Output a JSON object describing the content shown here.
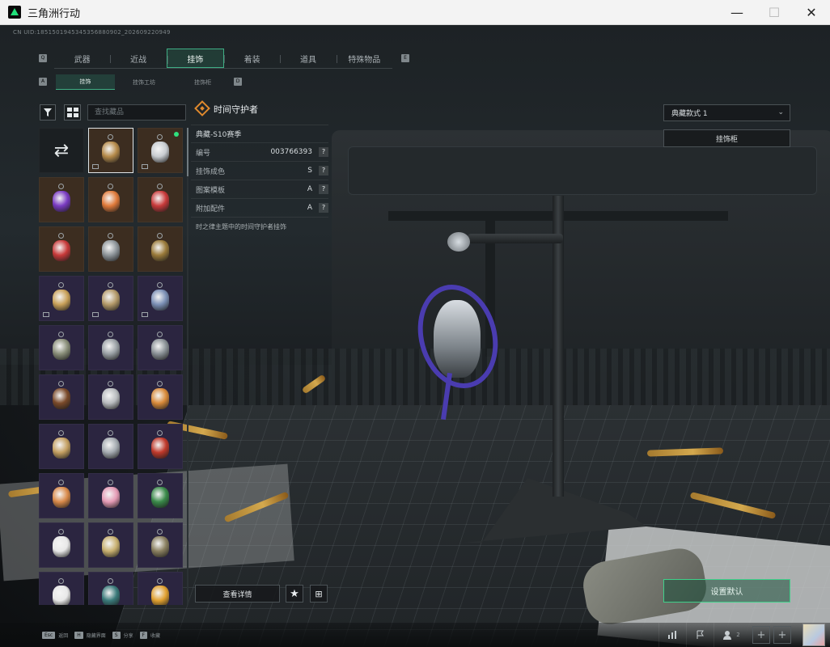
{
  "window": {
    "title": "三角洲行动",
    "minimize": "—",
    "maximize": "☐",
    "close": "✕"
  },
  "uid_text": "CN UID:1851501945345356880902_202609220949",
  "category_tabs": [
    {
      "label": "武器",
      "active": false
    },
    {
      "label": "近战",
      "active": false
    },
    {
      "label": "挂饰",
      "active": true
    },
    {
      "label": "着装",
      "active": false
    },
    {
      "label": "道具",
      "active": false
    },
    {
      "label": "特殊物品",
      "active": false
    }
  ],
  "tab_hints": {
    "prev": "Q",
    "next": "E",
    "sub_prev": "A",
    "sub_next": "D"
  },
  "sub_tabs": [
    {
      "label": "挂饰",
      "active": true
    },
    {
      "label": "挂饰工坊",
      "active": false
    },
    {
      "label": "挂饰柜",
      "active": false
    }
  ],
  "search": {
    "placeholder": "查找藏品",
    "value": ""
  },
  "item_grid": {
    "shuffle_icon": "⇄",
    "cells": [
      {
        "tier": "d",
        "kind": "shuffle"
      },
      {
        "tier": "o",
        "selected": true,
        "badge": true,
        "color": "#b58a4a"
      },
      {
        "tier": "o",
        "new": true,
        "badge": true,
        "color": "#c8ccd0"
      },
      {
        "tier": "o",
        "color": "#7a3bc2"
      },
      {
        "tier": "o",
        "color": "#e07a3a"
      },
      {
        "tier": "o",
        "color": "#c83a3a"
      },
      {
        "tier": "o",
        "color": "#c83a3a"
      },
      {
        "tier": "o",
        "color": "#8e959a"
      },
      {
        "tier": "o",
        "color": "#9a7a3a"
      },
      {
        "tier": "b",
        "badge": true,
        "color": "#c9a15a"
      },
      {
        "tier": "b",
        "badge": true,
        "color": "#b49a6a"
      },
      {
        "tier": "b",
        "badge": true,
        "color": "#7b8fb5"
      },
      {
        "tier": "b",
        "color": "#8a8f7a"
      },
      {
        "tier": "b",
        "color": "#9aa0a5"
      },
      {
        "tier": "b",
        "color": "#8a9196"
      },
      {
        "tier": "b",
        "color": "#7a4a2a"
      },
      {
        "tier": "b",
        "color": "#b9bcbf"
      },
      {
        "tier": "b",
        "color": "#d88a3a"
      },
      {
        "tier": "b",
        "color": "#c4a062"
      },
      {
        "tier": "b",
        "color": "#a4aab0"
      },
      {
        "tier": "b",
        "color": "#c0392b"
      },
      {
        "tier": "b",
        "color": "#d98a4a"
      },
      {
        "tier": "b",
        "color": "#e59bb5"
      },
      {
        "tier": "b",
        "color": "#3a8a4a"
      },
      {
        "tier": "b",
        "color": "#e8e8e8"
      },
      {
        "tier": "b",
        "color": "#c8b070"
      },
      {
        "tier": "b",
        "color": "#8a8060"
      },
      {
        "tier": "b",
        "color": "#e8e8e8"
      },
      {
        "tier": "b",
        "color": "#3a7a7a"
      },
      {
        "tier": "b",
        "color": "#e0a030"
      }
    ]
  },
  "detail": {
    "title": "时间守护者",
    "season": "典藏-S10赛季",
    "rows": [
      {
        "label": "编号",
        "value": "003766393"
      },
      {
        "label": "挂饰成色",
        "value": "S"
      },
      {
        "label": "图案模板",
        "value": "A"
      },
      {
        "label": "附加配件",
        "value": "A"
      }
    ],
    "help_glyph": "?",
    "description": "时之律主题中的时间守护者挂饰"
  },
  "actions": {
    "view_details": "查看详情",
    "favorite_icon": "★",
    "cart_icon": "⊞"
  },
  "right_panel": {
    "style_select": "典藏款式 1",
    "style_chevron": "⌄",
    "cabinet": "挂饰柜",
    "set_default": "设置默认"
  },
  "bottom_bar": {
    "hints": [
      {
        "key": "Esc",
        "label": "返回"
      },
      {
        "key": "H",
        "label": "隐藏界面"
      },
      {
        "key": "S",
        "label": "分享"
      },
      {
        "key": "F",
        "label": "收藏"
      }
    ],
    "friends_count": "2",
    "plus": "+"
  },
  "colors": {
    "accent": "#3fae84",
    "new_dot": "#2fe07d",
    "title_icon": "#e08a2d"
  }
}
